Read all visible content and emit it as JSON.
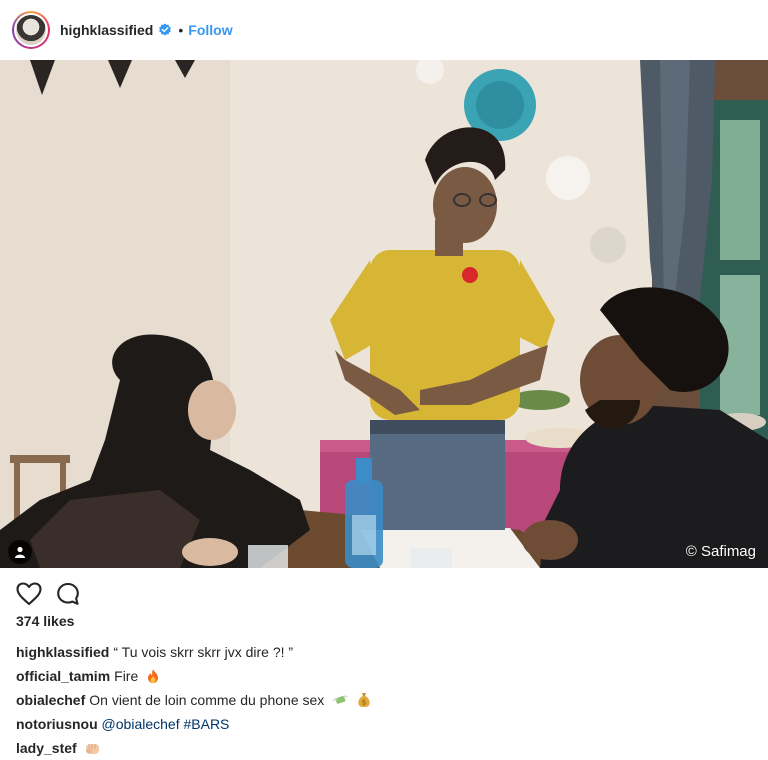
{
  "post": {
    "author": "highklassified",
    "verified": true,
    "separator": "•",
    "follow_label": "Follow",
    "photo_credit": "© Safimag",
    "likes": "374 likes"
  },
  "icons": {
    "verified": "verified-badge-icon",
    "like": "heart-icon",
    "comment": "comment-bubble-icon",
    "tags": "person-tag-icon"
  },
  "comments": [
    {
      "user": "highklassified",
      "text": "“ Tu vois skrr skrr jvx dire ?! ”"
    },
    {
      "user": "official_tamim",
      "text": "Fire",
      "emoji": "fire"
    },
    {
      "user": "obialechef",
      "text": "On vient de loin comme du phone sex",
      "emoji": "money-with-wings money-bag"
    },
    {
      "user": "notoriusnou",
      "mention": "@obialechef",
      "hashtag": "#BARS"
    },
    {
      "user": "lady_stef",
      "emoji": "fist-bump"
    }
  ],
  "colors": {
    "link": "#3897f0",
    "text": "#262626",
    "hashtag": "#003569"
  }
}
